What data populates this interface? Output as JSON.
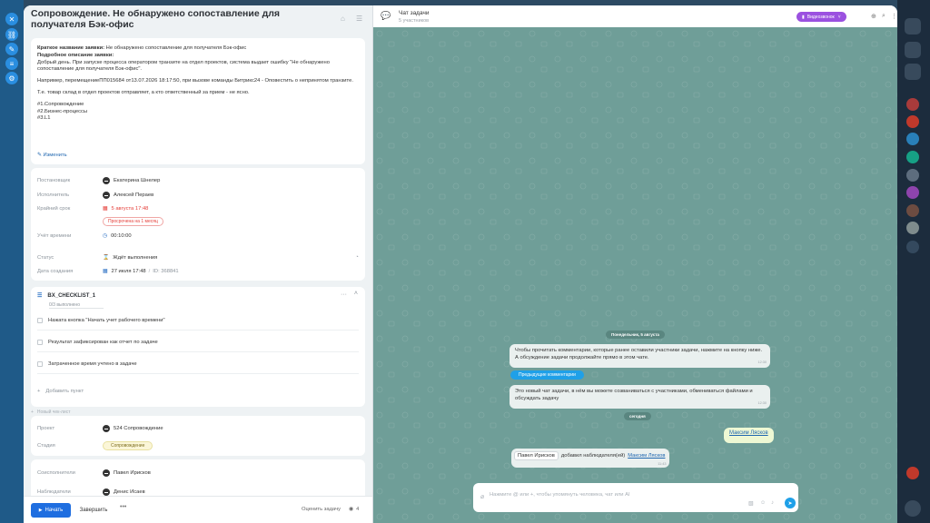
{
  "task": {
    "title": "Сопровождение. Не обнаружено сопоставление для получателя Бэк-офис",
    "desc_short_label": "Краткое название заявки:",
    "desc_short_value": "Не обнаружено сопоставление для получателя Бэк-офис",
    "desc_full_label": "Подробное описание заявки:",
    "desc_p1": "Добрый день. При запуске процесса оператором транзите на отдел проектов, система выдает ошибку \"Не обнаружено",
    "desc_p1b": "сопоставление для получателя Бэк-офис\".",
    "desc_p2": "Например, перемещениеПП015684 от13.07.2026 18:17:50, при вызове команды Битрикс24 - Оповестить о непринятом транзите.",
    "desc_p3": "Т.е. товар склад в отдел проектов отправляет, а кто ответственный за прием - не ясно.",
    "tag1": "#1.Сопровождение",
    "tag2": "#2.Бизнес-процессы",
    "tag3": "#3.L1",
    "edit_label": "Изменить"
  },
  "fields": {
    "creator_label": "Постановщик",
    "creator_value": "Екатерина Шнелер",
    "assignee_label": "Исполнитель",
    "assignee_value": "Алексей Пераев",
    "deadline_label": "Крайний срок",
    "deadline_value": "5 августа 17:48",
    "overdue_badge": "Просрочена на 1 месяц",
    "time_label": "Учёт времени",
    "time_value": "00:10:00",
    "status_label": "Статус",
    "status_value": "Ждёт выполнения",
    "created_label": "Дата создания",
    "created_value": "27 июля 17:48",
    "created_id": "ID: 368841"
  },
  "checklist": {
    "title": "BX_CHECKLIST_1",
    "progress": "0/3 выполнено",
    "items": [
      "Нажата кнопка \"Начать учет рабочего времени\"",
      "Результат зафиксирован как отчет по задаче",
      "Затраченное время учтено в задаче"
    ],
    "add_item": "Добавить пункт",
    "new_list": "Новый чек-лист"
  },
  "project": {
    "project_label": "Проект",
    "project_value": "524 Сопровождение",
    "stage_label": "Стадия",
    "stage_value": "Сопровождение"
  },
  "people": {
    "coexec_label": "Соисполнители",
    "coexec_value": "Павел Ирисков",
    "observers_label": "Наблюдатели",
    "observers_value": "Денис Исаев"
  },
  "footer": {
    "start": "Начать",
    "finish": "Завершить",
    "more": "•••",
    "rate": "Оценить задачу",
    "views": "4"
  },
  "chat": {
    "title": "Чат задачи",
    "subtitle": "5 участников",
    "video_btn": "Видеозвонок",
    "date1": "Понедельник, 5 августа",
    "msg1": "Чтобы прочитать комментарии, которые ранее оставили участники задачи, нажмите на кнопку ниже. А обсуждение задачи продолжайте прямо в этом чате.",
    "msg1_time": "12:30",
    "prev_btn": "Предыдущие комментарии",
    "msg2": "Это новый чат задачи, в нём вы можете созваниваться с участниками, обмениваться файлами и обсуждать задачу",
    "msg2_time": "12:30",
    "date2": "сегодня",
    "my_msg": "Максим Лясков",
    "sys_chip": "Павел Ирисков",
    "sys_text": "добавил наблюдателя(ей)",
    "sys_link": "Максим Лясков",
    "sys_time": "11:43",
    "composer_placeholder": "Нажмите @ или +, чтобы упомянуть человека, чат или AI"
  },
  "colors": {
    "accent": "#1f6ee0",
    "chat_bg": "#6f9e98",
    "video": "#9b51e0",
    "danger": "#e5403b"
  }
}
